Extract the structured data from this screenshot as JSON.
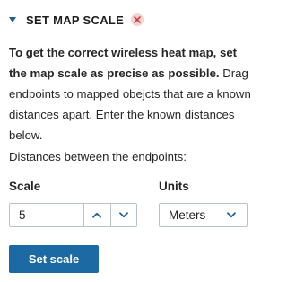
{
  "header": {
    "title": "SET MAP SCALE",
    "collapse_icon": "caret-down-icon",
    "close_icon": "close-icon",
    "accent_color": "#1f5f91",
    "close_color": "#d33c3c"
  },
  "description": {
    "bold_text": "To get the correct wireless heat map, set the map scale as precise as possible.",
    "normal_text": "Drag endpoints to mapped obejcts that are a known distances apart. Enter the known distances below."
  },
  "distances_label": "Distances between the endpoints:",
  "scale": {
    "label": "Scale",
    "value": "5",
    "increment_icon": "chevron-up-icon",
    "decrement_icon": "chevron-down-icon"
  },
  "units": {
    "label": "Units",
    "selected": "Meters",
    "dropdown_icon": "chevron-down-icon"
  },
  "submit": {
    "label": "Set scale",
    "color": "#1c6aa3"
  }
}
